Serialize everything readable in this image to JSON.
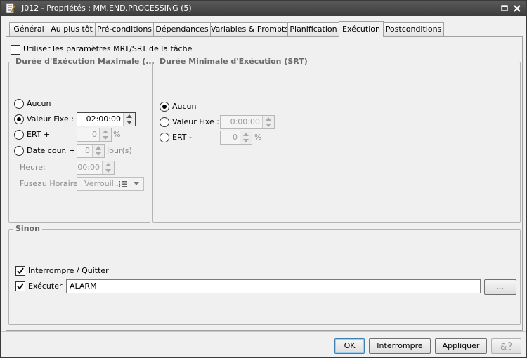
{
  "window": {
    "title": "J012 - Propriétés : MM.END.PROCESSING (5)"
  },
  "tabs": [
    {
      "label": "Général"
    },
    {
      "label": "Au plus tôt"
    },
    {
      "label": "Pré-conditions"
    },
    {
      "label": "Dépendances"
    },
    {
      "label": "Variables & Prompts"
    },
    {
      "label": "Planification"
    },
    {
      "label": "Exécution"
    },
    {
      "label": "Postconditions"
    }
  ],
  "active_tab": "Exécution",
  "use_task_params": {
    "label": "Utiliser les paramètres MRT/SRT de la tâche",
    "checked": false
  },
  "mrt": {
    "title": "Durée d'Exécution Maximale (...",
    "none_label": "Aucun",
    "fixed_label": "Valeur Fixe :",
    "fixed_value": "02:00:00",
    "ert_label": "ERT +",
    "ert_value": "0",
    "ert_unit": "%",
    "date_label": "Date cour. +",
    "date_value": "0",
    "date_unit": "Jour(s)",
    "hour_label": "Heure:",
    "hour_value": "00:00",
    "tz_label": "Fuseau Horaire:",
    "tz_value": "Verrouil...",
    "selected": "fixed"
  },
  "srt": {
    "title": "Durée Minimale d'Exécution (SRT)",
    "none_label": "Aucun",
    "fixed_label": "Valeur Fixe :",
    "fixed_value": "0:00:00",
    "ert_label": "ERT -",
    "ert_value": "0",
    "ert_unit": "%",
    "selected": "none"
  },
  "else": {
    "title": "Sinon",
    "abort_label": "Interrompre / Quitter",
    "abort_checked": true,
    "exec_label": "Exécuter",
    "exec_checked": true,
    "exec_value": "ALARM",
    "browse_label": "..."
  },
  "footer": {
    "ok": "OK",
    "abort": "Interrompre",
    "apply": "Appliquer"
  }
}
